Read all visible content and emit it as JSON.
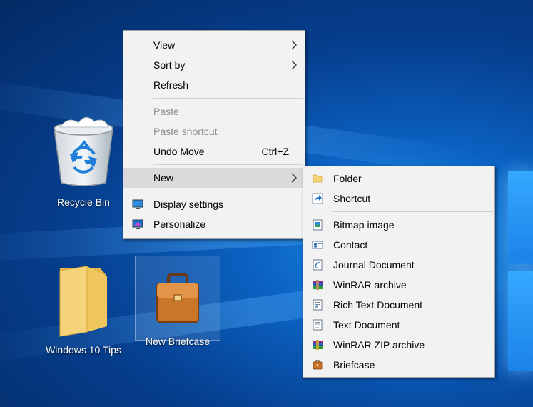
{
  "desktop_icons": {
    "recycle_bin": "Recycle Bin",
    "folder": "Windows 10 Tips",
    "briefcase": "New Briefcase"
  },
  "context_menu": {
    "view": "View",
    "sort_by": "Sort by",
    "refresh": "Refresh",
    "paste": "Paste",
    "paste_shortcut": "Paste shortcut",
    "undo_move": "Undo Move",
    "undo_shortcut": "Ctrl+Z",
    "new": "New",
    "display_settings": "Display settings",
    "personalize": "Personalize"
  },
  "new_submenu": {
    "folder": "Folder",
    "shortcut": "Shortcut",
    "bitmap": "Bitmap image",
    "contact": "Contact",
    "journal": "Journal Document",
    "winrar": "WinRAR archive",
    "rtf": "Rich Text Document",
    "text": "Text Document",
    "winrar_zip": "WinRAR ZIP archive",
    "briefcase": "Briefcase"
  },
  "colors": {
    "menu_bg": "#f2f2f2",
    "highlight": "#dadada",
    "disabled_text": "#8d8d8d",
    "desktop_blue": "#0b62c2"
  }
}
